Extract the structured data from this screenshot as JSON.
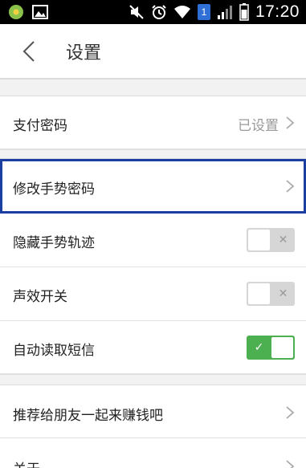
{
  "status_bar": {
    "time": "17:20",
    "sim_badge": "1",
    "icons": [
      "app-notification-icon",
      "image-notification-icon",
      "mute-icon",
      "alarm-icon",
      "wifi-icon",
      "signal-icon",
      "battery-icon"
    ]
  },
  "header": {
    "title": "设置",
    "back_icon": "chevron-left-icon"
  },
  "settings": {
    "payment_password": {
      "label": "支付密码",
      "value": "已设置"
    },
    "modify_gesture_password": {
      "label": "修改手势密码"
    },
    "hide_gesture_trail": {
      "label": "隐藏手势轨迹",
      "enabled": false
    },
    "sound_effects": {
      "label": "声效开关",
      "enabled": false
    },
    "auto_read_sms": {
      "label": "自动读取短信",
      "enabled": true
    },
    "recommend_friends": {
      "label": "推荐给朋友一起来赚钱吧"
    },
    "about": {
      "label": "关于"
    }
  },
  "colors": {
    "toggle_on": "#4caf50",
    "toggle_off": "#d6d6d6",
    "focus_outline": "#1a3fa0",
    "section_gap": "#f2f2f2"
  }
}
